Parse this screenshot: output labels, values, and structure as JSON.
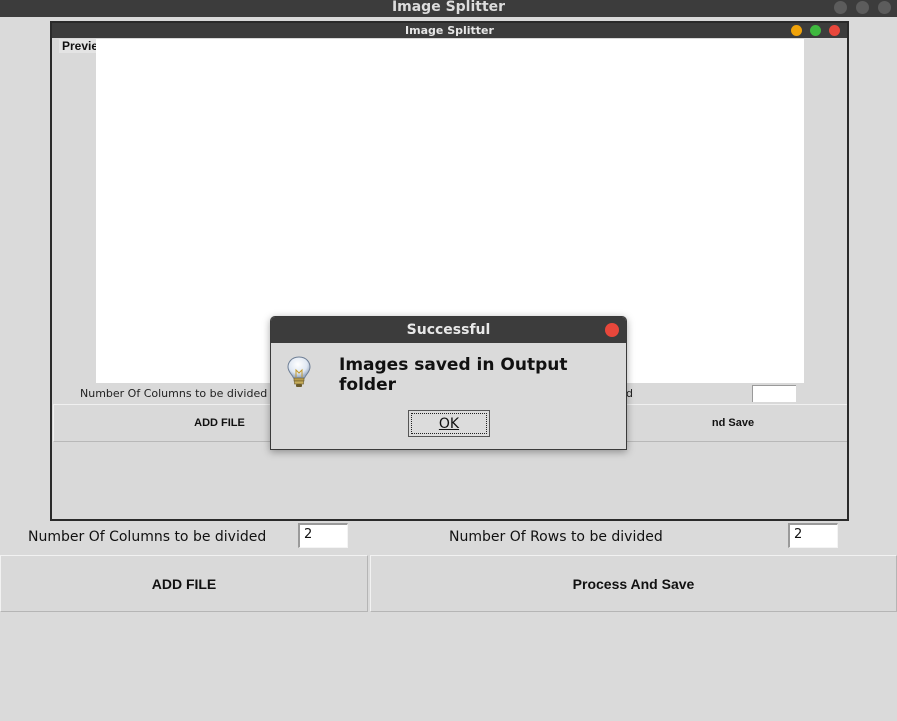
{
  "window": {
    "title": "Image Splitter"
  },
  "inner_window": {
    "title": "Image Splitter",
    "preview_label": "Preview",
    "columns_label": "Number Of Columns to be divided",
    "rows_label_fragment": "d",
    "add_file_label": "ADD FILE",
    "process_label_fragment": "nd Save"
  },
  "controls": {
    "columns_label": "Number Of Columns to be divided",
    "columns_value": "2",
    "rows_label": "Number Of Rows to be divided",
    "rows_value": "2",
    "add_file_label": "ADD FILE",
    "process_label": "Process And Save"
  },
  "dialog": {
    "title": "Successful",
    "message": "Images saved in Output folder",
    "ok_label": "OK",
    "icon": "lightbulb-icon"
  },
  "colors": {
    "titlebar": "#3c3c3c",
    "background": "#dadada",
    "close": "#e8473b",
    "minimize": "#f0a30a",
    "maximize": "#3fb93f"
  }
}
